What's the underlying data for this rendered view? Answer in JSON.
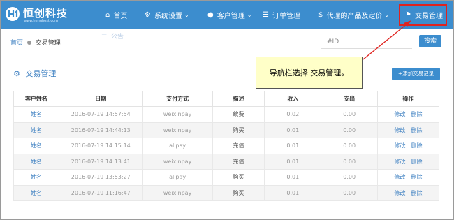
{
  "brand": {
    "name": "恒创科技",
    "site": "www.henghost.com"
  },
  "nav": {
    "home": "首页",
    "settings": "系统设置",
    "customers": "客户管理",
    "orders": "订单管理",
    "agent_products": "代理的产品及定价",
    "trades": "交易管理"
  },
  "breadcrumb": {
    "home": "首页",
    "current": "交易管理"
  },
  "notice": "公告",
  "search": {
    "placeholder": "#ID",
    "button": "搜索"
  },
  "section": {
    "title": "交易管理",
    "add_button": "+添加交易记录"
  },
  "callout": "导航栏选择 交易管理。",
  "table": {
    "columns": [
      "客户姓名",
      "日期",
      "支付方式",
      "描述",
      "收入",
      "支出",
      "操作"
    ],
    "edit_label": "修改",
    "delete_label": "删除",
    "rows": [
      {
        "name": "姓名",
        "date": "2016-07-19 14:57:54",
        "method": "weixinpay",
        "desc": "续费",
        "income": "0.02",
        "expense": "0.00"
      },
      {
        "name": "姓名",
        "date": "2016-07-19 14:44:13",
        "method": "weixinpay",
        "desc": "购买",
        "income": "0.01",
        "expense": "0.00"
      },
      {
        "name": "姓名",
        "date": "2016-07-19 14:15:14",
        "method": "alipay",
        "desc": "充值",
        "income": "0.01",
        "expense": "0.00"
      },
      {
        "name": "姓名",
        "date": "2016-07-19 14:13:41",
        "method": "weixinpay",
        "desc": "充值",
        "income": "0.01",
        "expense": "0.00"
      },
      {
        "name": "姓名",
        "date": "2016-07-19 13:53:27",
        "method": "alipay",
        "desc": "购买",
        "income": "0.01",
        "expense": "0.00"
      },
      {
        "name": "姓名",
        "date": "2016-07-19 11:16:47",
        "method": "weixinpay",
        "desc": "购买",
        "income": "0.01",
        "expense": "0.00"
      }
    ]
  },
  "colors": {
    "primary": "#3c8dce",
    "link": "#3c7fc1",
    "highlight_border": "#e0231f",
    "callout_bg": "#ffffc8"
  },
  "icons": {
    "home": "home-icon",
    "settings": "gear-icon",
    "customers": "user-icon",
    "orders": "list-icon",
    "agent": "dollar-icon",
    "trades": "tag-icon",
    "notice": "list-icon",
    "section": "gear-icon"
  }
}
